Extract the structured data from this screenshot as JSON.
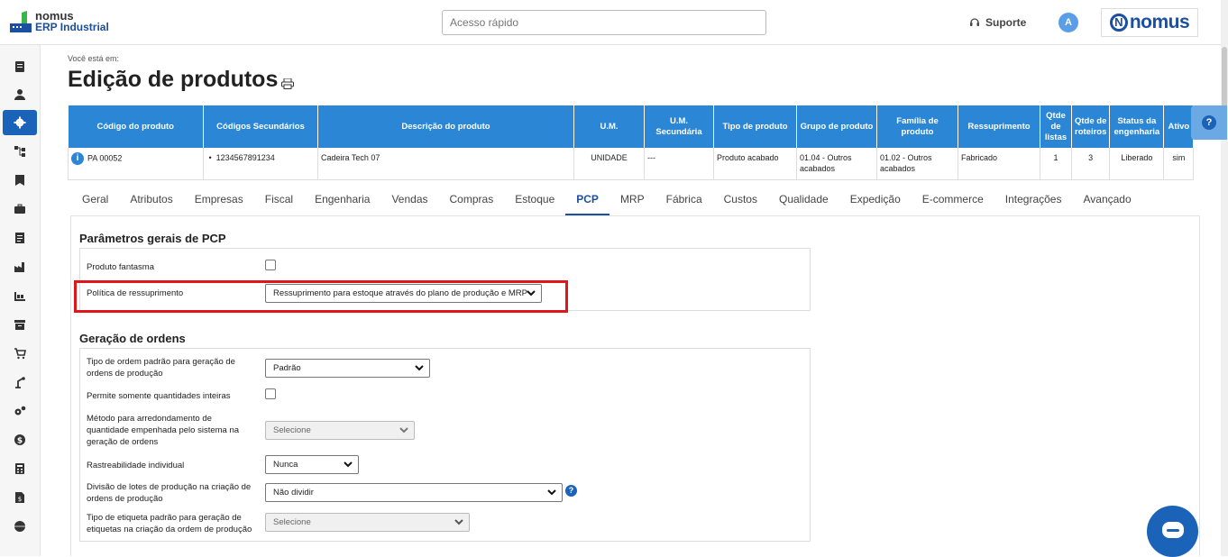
{
  "header": {
    "logo_line1": "nomus",
    "logo_line2": "ERP Industrial",
    "search_placeholder": "Acesso rápido",
    "support_label": "Suporte",
    "avatar_initial": "A",
    "brand": "nomus"
  },
  "sidebar": {
    "items": [
      "notes-icon",
      "user-icon",
      "gear-icon",
      "hierarchy-icon",
      "flag-icon",
      "briefcase-icon",
      "document-icon",
      "factory-icon",
      "production-icon",
      "archive-icon",
      "cart-icon",
      "machine-icon",
      "cogs-icon",
      "money-icon",
      "calculator-icon",
      "invoice-icon",
      "globe-icon"
    ],
    "active_index": 2
  },
  "page": {
    "breadcrumb": "Você está em:",
    "title": "Edição de produtos"
  },
  "product_table": {
    "headers": [
      "Código do produto",
      "Códigos Secundários",
      "Descrição do produto",
      "U.M.",
      "U.M. Secundária",
      "Tipo de produto",
      "Grupo de produto",
      "Família de produto",
      "Ressuprimento",
      "Qtde de listas",
      "Qtde de roteiros",
      "Status da engenharia",
      "Ativo"
    ],
    "row": {
      "codigo": "PA 00052",
      "secundarios": "1234567891234",
      "descricao": "Cadeira Tech 07",
      "um": "UNIDADE",
      "um_sec": "---",
      "tipo": "Produto acabado",
      "grupo": "01.04 - Outros acabados",
      "familia": "01.02 - Outros acabados",
      "ressuprimento": "Fabricado",
      "listas": "1",
      "roteiros": "3",
      "status": "Liberado",
      "ativo": "sim"
    }
  },
  "tabs": [
    "Geral",
    "Atributos",
    "Empresas",
    "Fiscal",
    "Engenharia",
    "Vendas",
    "Compras",
    "Estoque",
    "PCP",
    "MRP",
    "Fábrica",
    "Custos",
    "Qualidade",
    "Expedição",
    "E-commerce",
    "Integrações",
    "Avançado"
  ],
  "active_tab": "PCP",
  "pcp": {
    "section1_title": "Parâmetros gerais de PCP",
    "produto_fantasma_label": "Produto fantasma",
    "politica_label": "Política de ressuprimento",
    "politica_value": "Ressuprimento para estoque através do plano de produção e MRP",
    "section2_title": "Geração de ordens",
    "tipo_ordem_label": "Tipo de ordem padrão para geração de ordens de produção",
    "tipo_ordem_value": "Padrão",
    "qtd_inteiras_label": "Permite somente quantidades inteiras",
    "arredondamento_label": "Método para arredondamento de quantidade empenhada pelo sistema na geração de ordens",
    "arredondamento_value": "Selecione",
    "rastreabilidade_label": "Rastreabilidade individual",
    "rastreabilidade_value": "Nunca",
    "divisao_label": "Divisão de lotes de produção na criação de ordens de produção",
    "divisao_value": "Não dividir",
    "etiqueta_label": "Tipo de etiqueta padrão para geração de etiquetas na criação da ordem de produção",
    "etiqueta_value": "Selecione"
  },
  "colors": {
    "primary": "#2b87d6",
    "sidebar_active": "#1b63b8",
    "highlight": "#e0161b"
  }
}
